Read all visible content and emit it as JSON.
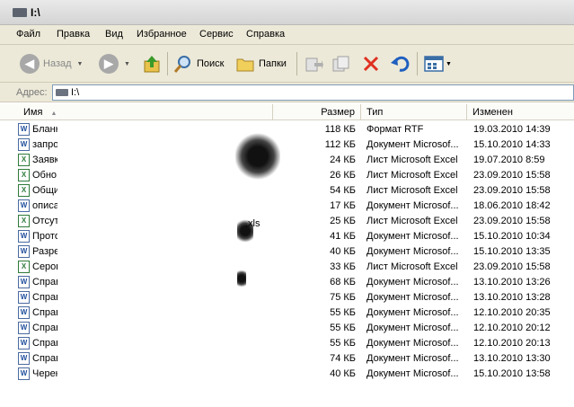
{
  "window": {
    "title": "I:\\"
  },
  "menu": [
    "Файл",
    "Правка",
    "Вид",
    "Избранное",
    "Сервис",
    "Справка"
  ],
  "toolbar": {
    "back_label": "Назад",
    "search_label": "Поиск",
    "folders_label": "Папки"
  },
  "address": {
    "label": "Адрес:",
    "value": "I:\\"
  },
  "columns": {
    "name": "Имя",
    "size": "Размер",
    "type": "Тип",
    "modified": "Изменен"
  },
  "files": [
    {
      "name": "Бланк",
      "icon": "word",
      "size": "118 КБ",
      "type": "Формат RTF",
      "modified": "19.03.2010 14:39"
    },
    {
      "name": "запро",
      "icon": "word",
      "size": "112 КБ",
      "type": "Документ Microsof...",
      "modified": "15.10.2010 14:33"
    },
    {
      "name": "Заявк",
      "icon": "excel",
      "size": "24 КБ",
      "type": "Лист Microsoft Excel",
      "modified": "19.07.2010 8:59"
    },
    {
      "name": "Обно",
      "icon": "excel",
      "size": "26 КБ",
      "type": "Лист Microsoft Excel",
      "modified": "23.09.2010 15:58"
    },
    {
      "name": "Общи",
      "icon": "excel",
      "size": "54 КБ",
      "type": "Лист Microsoft Excel",
      "modified": "23.09.2010 15:58"
    },
    {
      "name": "описа",
      "icon": "word",
      "size": "17 КБ",
      "type": "Документ Microsof...",
      "modified": "18.06.2010 18:42"
    },
    {
      "name": "Отсут",
      "icon": "excel",
      "size": "25 КБ",
      "type": "Лист Microsoft Excel",
      "modified": "23.09.2010 15:58"
    },
    {
      "name": "Прото",
      "icon": "word",
      "size": "41 КБ",
      "type": "Документ Microsof...",
      "modified": "15.10.2010 10:34"
    },
    {
      "name": "Разре",
      "icon": "word",
      "size": "40 КБ",
      "type": "Документ Microsof...",
      "modified": "15.10.2010 13:35"
    },
    {
      "name": "Серов",
      "icon": "excel",
      "size": "33 КБ",
      "type": "Лист Microsoft Excel",
      "modified": "23.09.2010 15:58"
    },
    {
      "name": "Справ",
      "icon": "word",
      "size": "68 КБ",
      "type": "Документ Microsof...",
      "modified": "13.10.2010 13:26"
    },
    {
      "name": "Справ",
      "icon": "word",
      "size": "75 КБ",
      "type": "Документ Microsof...",
      "modified": "13.10.2010 13:28"
    },
    {
      "name": "Справ",
      "icon": "word",
      "size": "55 КБ",
      "type": "Документ Microsof...",
      "modified": "12.10.2010 20:35"
    },
    {
      "name": "Справ",
      "icon": "word",
      "size": "55 КБ",
      "type": "Документ Microsof...",
      "modified": "12.10.2010 20:12"
    },
    {
      "name": "Справ",
      "icon": "word",
      "size": "55 КБ",
      "type": "Документ Microsof...",
      "modified": "12.10.2010 20:13"
    },
    {
      "name": "Справ",
      "icon": "word",
      "size": "74 КБ",
      "type": "Документ Microsof...",
      "modified": "13.10.2010 13:30"
    },
    {
      "name": "Черен",
      "icon": "word",
      "size": "40 КБ",
      "type": "Документ Microsof...",
      "modified": "15.10.2010 13:58"
    }
  ],
  "fragment": ".xls",
  "colors": {
    "chrome": "#ece9d8",
    "back_arrow": "#a8a8a8",
    "up_arrow": "#3a9a2a",
    "delete": "#e03020",
    "undo": "#1f5fbf"
  }
}
